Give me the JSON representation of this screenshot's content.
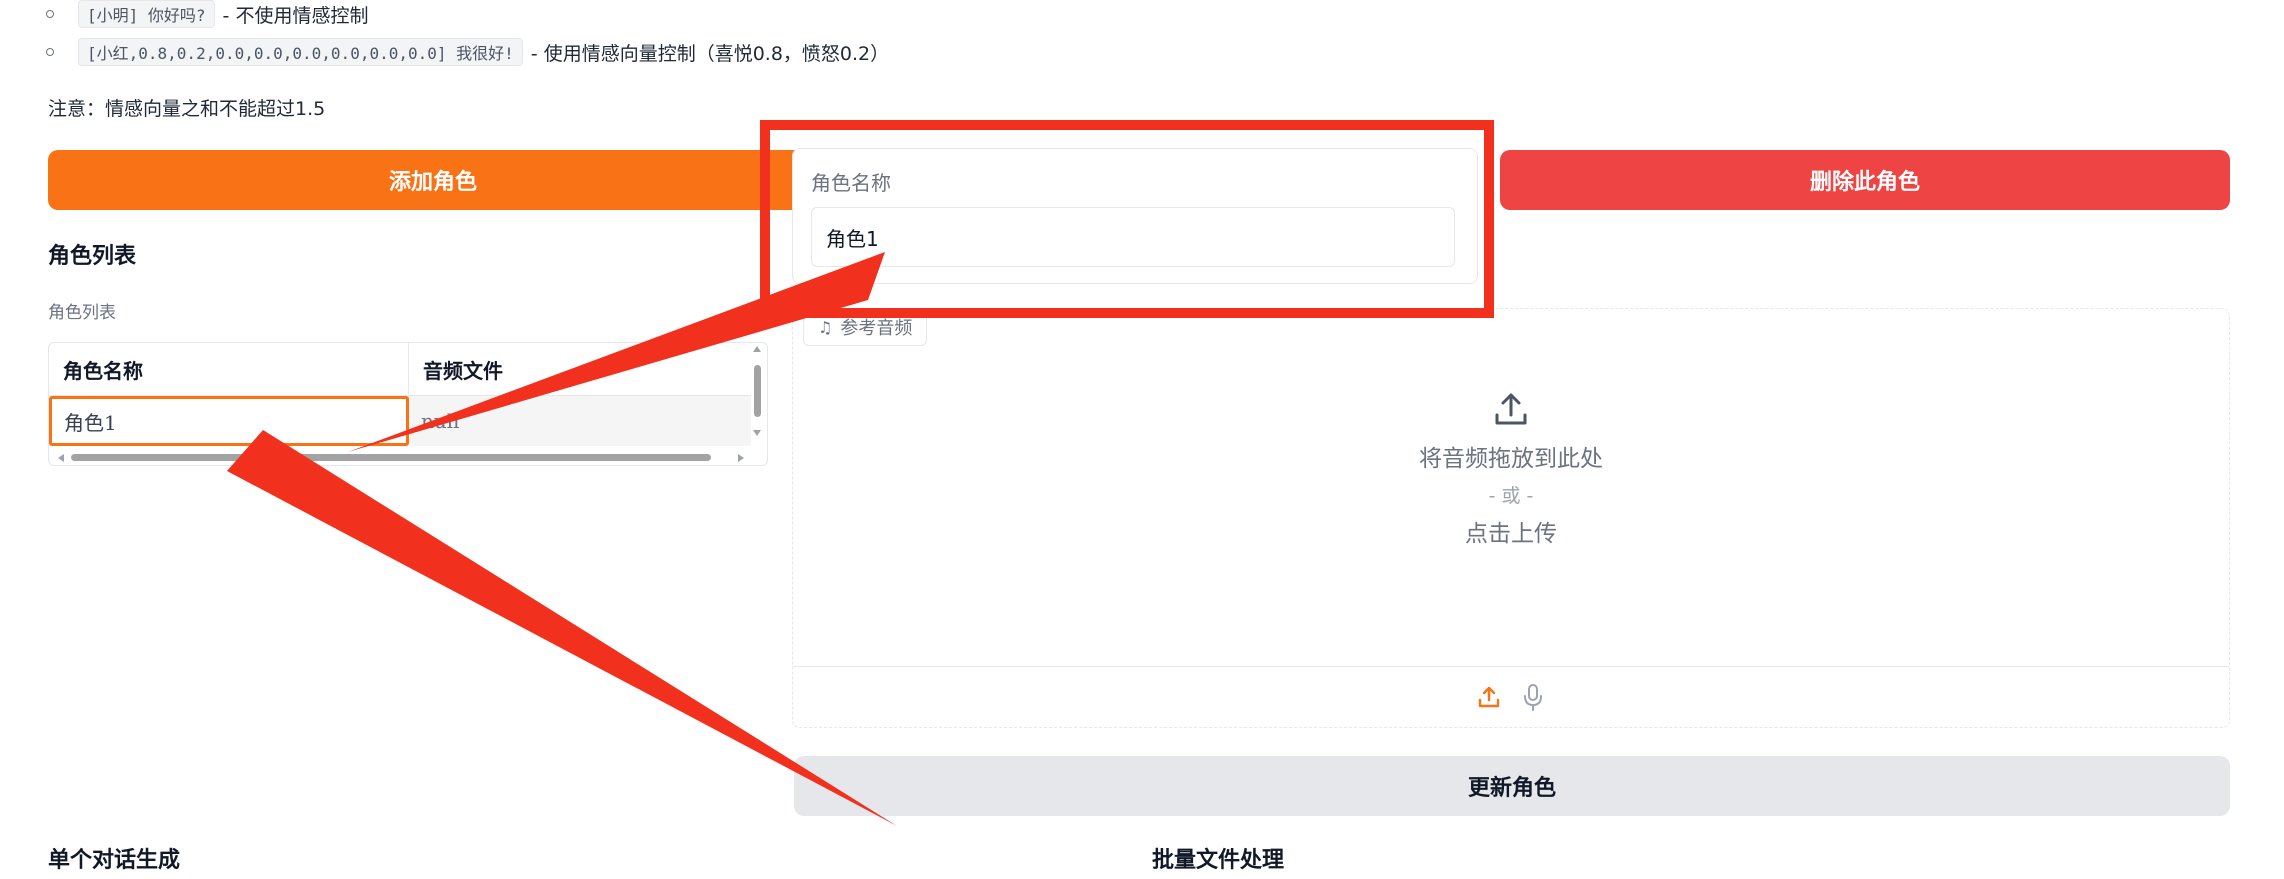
{
  "examples": [
    {
      "code": "[小明] 你好吗?",
      "desc": "- 不使用情感控制"
    },
    {
      "code": "[小红,0.8,0.2,0.0,0.0,0.0,0.0,0.0,0.0] 我很好!",
      "desc": "- 使用情感向量控制（喜悦0.8，愤怒0.2）"
    }
  ],
  "note": "注意：情感向量之和不能超过1.5",
  "buttons": {
    "add_role": "添加角色",
    "delete_role": "删除此角色",
    "update_role": "更新角色"
  },
  "role_list": {
    "title": "角色列表",
    "label": "角色列表",
    "columns": [
      "角色名称",
      "音频文件"
    ],
    "rows": [
      [
        "角色1",
        "null"
      ]
    ]
  },
  "role_editor": {
    "label": "角色名称",
    "value": "角色1"
  },
  "audio": {
    "tag": "参考音频",
    "drop_text": "将音频拖放到此处",
    "or_text": "- 或 -",
    "click_text": "点击上传",
    "icons": [
      "upload-icon",
      "microphone-icon"
    ]
  },
  "sections": {
    "single": "单个对话生成",
    "batch": "批量文件处理"
  },
  "colors": {
    "accent_orange": "#f97316",
    "danger_red": "#ef4444",
    "annotation_red": "#f1301d"
  }
}
